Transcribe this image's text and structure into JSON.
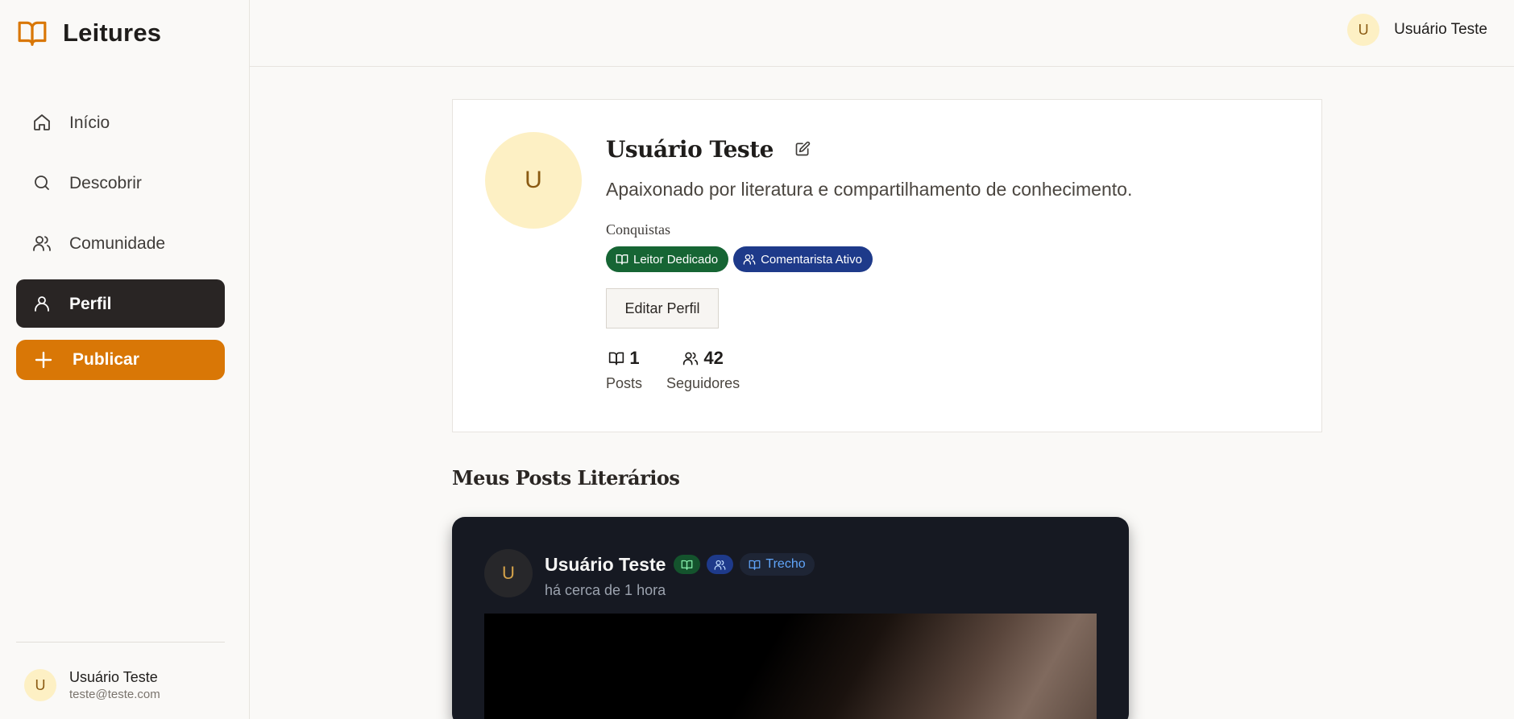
{
  "app": {
    "title": "Leitures",
    "logo_icon": "book-open-icon",
    "accent": "#d97706"
  },
  "sidebar": {
    "items": [
      {
        "label": "Início",
        "icon": "home-icon"
      },
      {
        "label": "Descobrir",
        "icon": "search-icon"
      },
      {
        "label": "Comunidade",
        "icon": "users-icon"
      },
      {
        "label": "Perfil",
        "icon": "user-icon",
        "active": true
      }
    ],
    "publish_label": "Publicar",
    "user": {
      "initial": "U",
      "name": "Usuário Teste",
      "email": "teste@teste.com"
    }
  },
  "header": {
    "user": {
      "initial": "U",
      "name": "Usuário Teste"
    }
  },
  "profile": {
    "initial": "U",
    "name": "Usuário Teste",
    "bio": "Apaixonado por literatura e compartilhamento de conhecimento.",
    "achievements_title": "Conquistas",
    "achievements": [
      {
        "label": "Leitor Dedicado",
        "icon": "book-open-icon",
        "color": "#166534"
      },
      {
        "label": "Comentarista Ativo",
        "icon": "users-icon",
        "color": "#1e3a8a"
      }
    ],
    "edit_label": "Editar Perfil",
    "stats": [
      {
        "value": "1",
        "label": "Posts",
        "icon": "book-open-icon"
      },
      {
        "value": "42",
        "label": "Seguidores",
        "icon": "users-icon"
      }
    ]
  },
  "posts_section": {
    "title": "Meus Posts Literários"
  },
  "post": {
    "initial": "U",
    "author": "Usuário Teste",
    "tag": "Trecho",
    "time": "há cerca de 1 hora"
  }
}
